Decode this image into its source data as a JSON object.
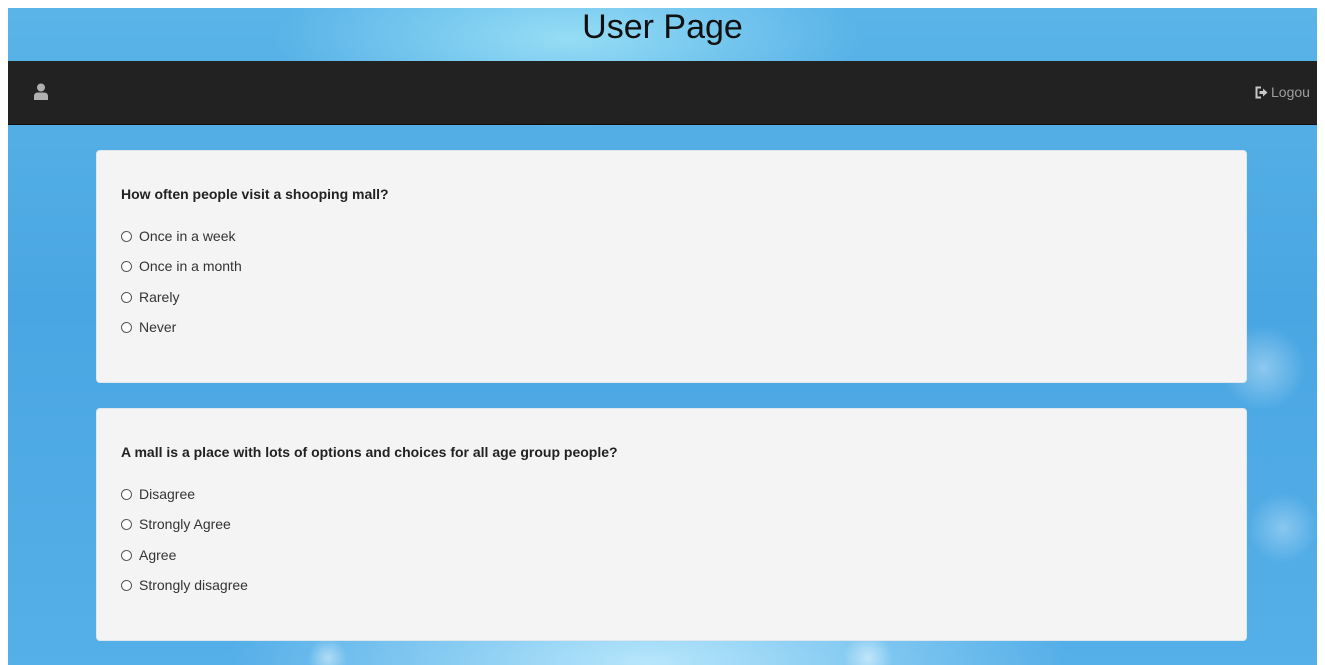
{
  "page": {
    "title": "User Page"
  },
  "nav": {
    "user_icon": "user-icon",
    "logout_icon": "logout-icon",
    "logout_label": "Logou"
  },
  "questions": [
    {
      "text": "How often people visit a shooping mall?",
      "options": [
        "Once in a week",
        "Once in a month",
        "Rarely",
        "Never"
      ]
    },
    {
      "text": "A mall is a place with lots of options and choices for all age group people?",
      "options": [
        "Disagree",
        "Strongly Agree",
        "Agree",
        "Strongly disagree"
      ]
    }
  ],
  "colors": {
    "navbar": "#222222",
    "card": "#f4f4f4",
    "background": "#4aa6e2"
  }
}
